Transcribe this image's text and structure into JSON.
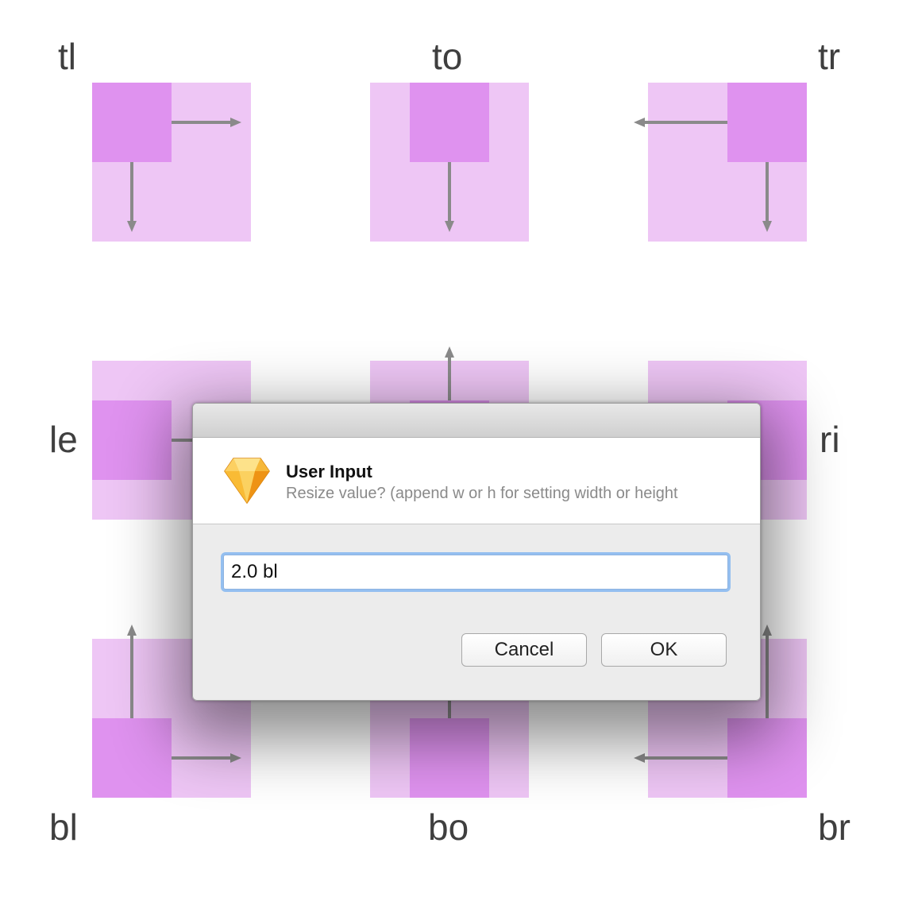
{
  "colors": {
    "outer_square": "#eec6f5",
    "inner_square": "#df92ef",
    "arrow": "#8a8a8a",
    "label_text": "#3f3f3f"
  },
  "anchors": {
    "tl": "tl",
    "to": "to",
    "tr": "tr",
    "le": "le",
    "ri": "ri",
    "bl": "bl",
    "bo": "bo",
    "br": "br"
  },
  "dialog": {
    "title": "User Input",
    "message": "Resize value? (append w or h for setting width or height",
    "input_value": "2.0 bl",
    "cancel_label": "Cancel",
    "ok_label": "OK",
    "app_icon": "sketch-diamond-icon"
  }
}
